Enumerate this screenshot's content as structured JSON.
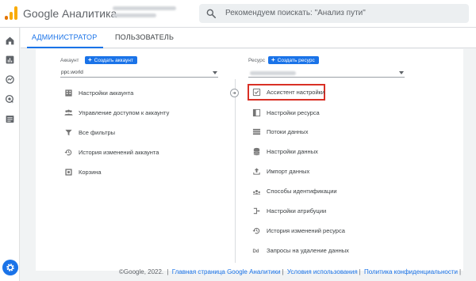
{
  "header": {
    "brand": "Google Аналитика",
    "search_placeholder": "Рекомендуем поискать: \"Анализ пути\""
  },
  "tabs": [
    {
      "label": "АДМИНИСТРАТОР",
      "active": true
    },
    {
      "label": "ПОЛЬЗОВАТЕЛЬ",
      "active": false
    }
  ],
  "account": {
    "label": "Аккаунт",
    "create_button": "Создать аккаунт",
    "selected": "ppc.world",
    "items": [
      {
        "label": "Настройки аккаунта",
        "icon": "building-icon"
      },
      {
        "label": "Управление доступом к аккаунту",
        "icon": "people-icon"
      },
      {
        "label": "Все фильтры",
        "icon": "filter-icon"
      },
      {
        "label": "История изменений аккаунта",
        "icon": "history-icon"
      },
      {
        "label": "Корзина",
        "icon": "trash-icon"
      }
    ]
  },
  "property": {
    "label": "Ресурс",
    "create_button": "Создать ресурс",
    "items": [
      {
        "label": "Ассистент настройки",
        "icon": "checklist-icon",
        "highlighted": true
      },
      {
        "label": "Настройки ресурса",
        "icon": "property-settings-icon"
      },
      {
        "label": "Потоки данных",
        "icon": "data-streams-icon"
      },
      {
        "label": "Настройки данных",
        "icon": "database-icon"
      },
      {
        "label": "Импорт данных",
        "icon": "upload-icon"
      },
      {
        "label": "Способы идентификации",
        "icon": "identity-icon"
      },
      {
        "label": "Настройки атрибуции",
        "icon": "attribution-icon"
      },
      {
        "label": "История изменений ресурса",
        "icon": "history-icon"
      },
      {
        "label": "Запросы на удаление данных",
        "icon": "dd-icon"
      }
    ]
  },
  "footer": {
    "copyright": "©Google, 2022.",
    "links": [
      "Главная страница Google Аналитики",
      "Условия использования",
      "Политика конфиденциальности"
    ]
  },
  "colors": {
    "accent": "#1a73e8",
    "highlight_border": "#d93025",
    "logo_orange": "#f9ab00",
    "logo_dark_orange": "#e37400"
  }
}
